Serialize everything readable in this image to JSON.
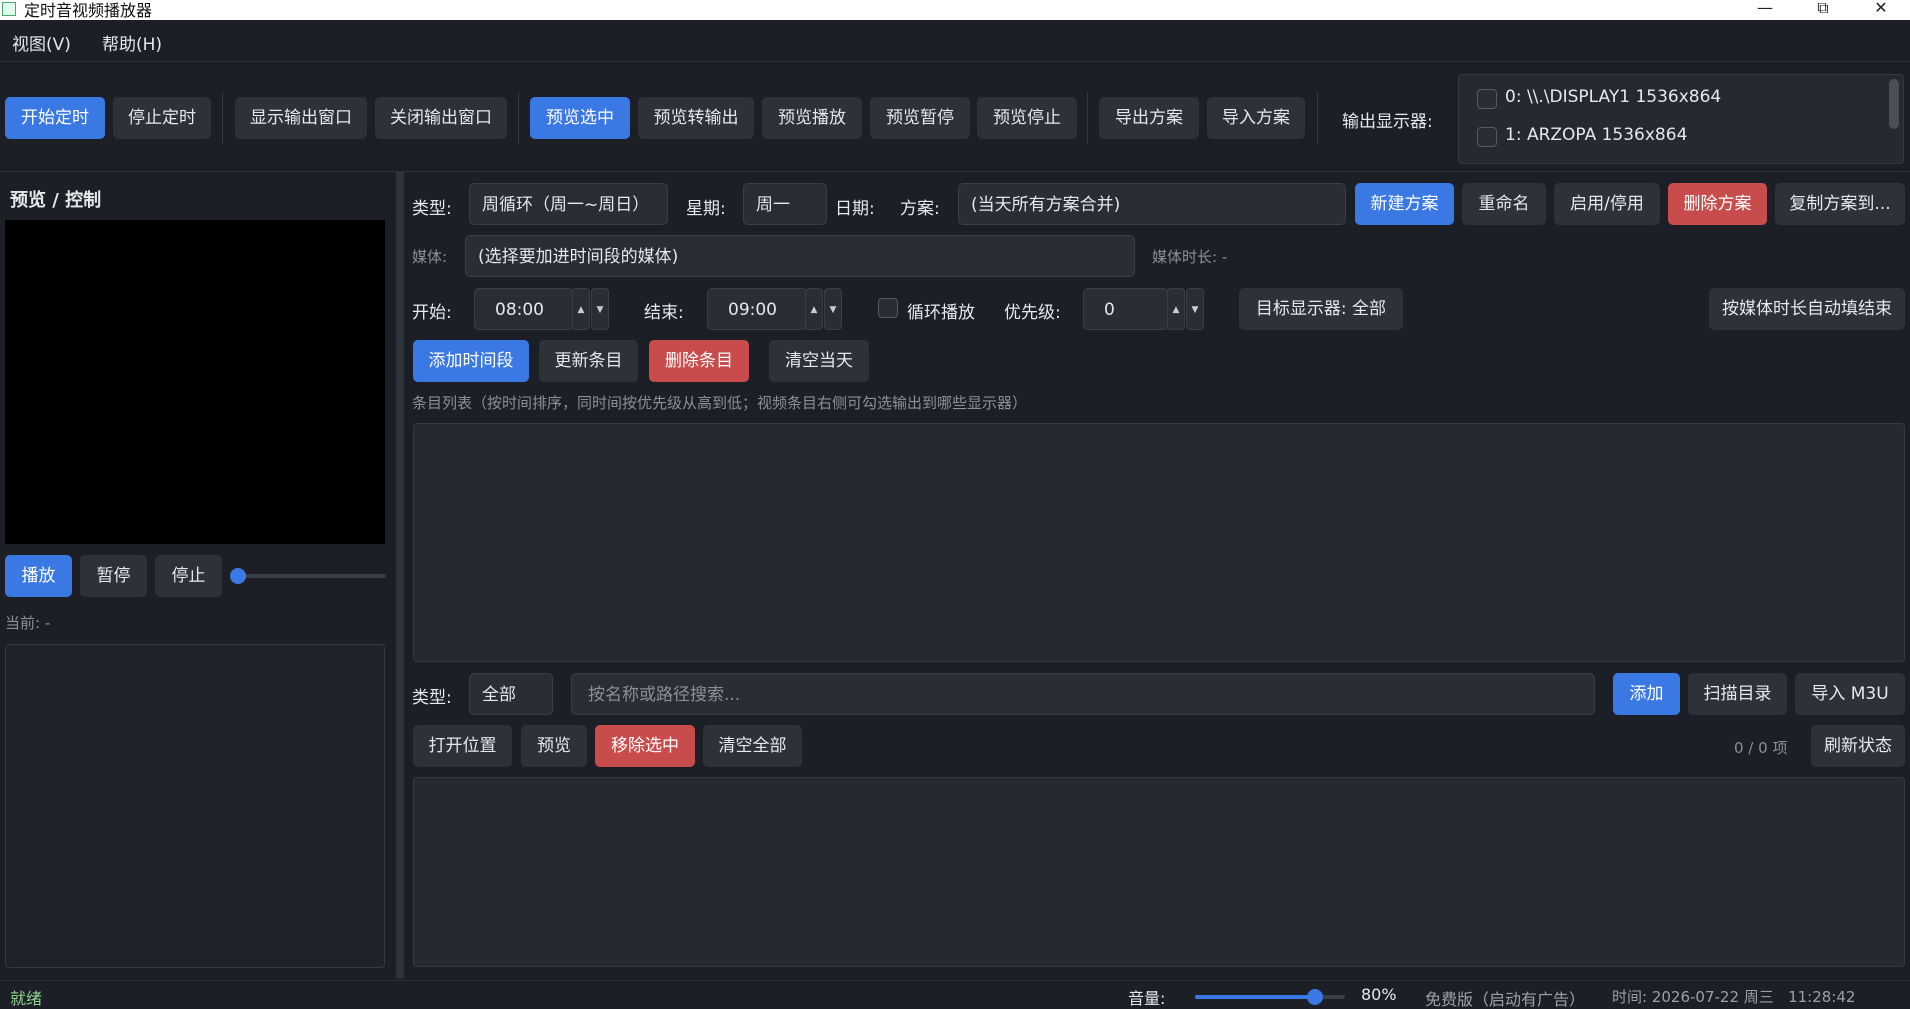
{
  "window": {
    "title": "定时音视频播放器",
    "minimize": "—",
    "maximize": "⧉",
    "close": "✕"
  },
  "menu": {
    "view": "视图(V)",
    "help": "帮助(H)"
  },
  "toolbar": {
    "start_timer": "开始定时",
    "stop_timer": "停止定时",
    "show_output": "显示输出窗口",
    "close_output": "关闭输出窗口",
    "preview_selected": "预览选中",
    "preview_to_output": "预览转输出",
    "preview_play": "预览播放",
    "preview_pause": "预览暂停",
    "preview_stop": "预览停止",
    "export_plan": "导出方案",
    "import_plan": "导入方案",
    "output_display_label": "输出显示器:",
    "displays": [
      "0: \\\\.\\DISPLAY1  1536x864",
      "1: ARZOPA  1536x864"
    ]
  },
  "left_panel": {
    "title": "预览 / 控制",
    "play": "播放",
    "pause": "暂停",
    "stop": "停止",
    "current": "当前: -"
  },
  "schedule": {
    "type_label": "类型:",
    "type_value": "周循环（周一~周日）",
    "weekday_label": "星期:",
    "weekday_value": "周一",
    "date_label": "日期:",
    "plan_label": "方案:",
    "plan_value": "(当天所有方案合并)",
    "new_plan": "新建方案",
    "rename": "重命名",
    "enable_disable": "启用/停用",
    "delete_plan": "删除方案",
    "copy_plan": "复制方案到...",
    "media_label": "媒体:",
    "media_value": "(选择要加进时间段的媒体)",
    "media_duration": "媒体时长: -",
    "start_label": "开始:",
    "start_value": "08:00",
    "end_label": "结束:",
    "end_value": "09:00",
    "loop_label": "循环播放",
    "priority_label": "优先级:",
    "priority_value": "0",
    "target_display": "目标显示器: 全部",
    "auto_fill_end": "按媒体时长自动填结束",
    "add_segment": "添加时间段",
    "update_item": "更新条目",
    "delete_item": "删除条目",
    "clear_day": "清空当天",
    "list_hint": "条目列表（按时间排序，同时间按优先级从高到低；视频条目右侧可勾选输出到哪些显示器）"
  },
  "library": {
    "type_label": "类型:",
    "type_value": "全部",
    "search_placeholder": "按名称或路径搜索...",
    "add": "添加",
    "scan_dir": "扫描目录",
    "import_m3u": "导入 M3U",
    "open_location": "打开位置",
    "preview": "预览",
    "remove_selected": "移除选中",
    "clear_all": "清空全部",
    "count": "0 / 0 项",
    "refresh_status": "刷新状态"
  },
  "status": {
    "ready": "就绪",
    "volume_label": "音量:",
    "volume_value": "80%",
    "volume_level": 0.8,
    "edition": "免费版（启动有广告）",
    "time": "时间: 2026-07-22 周三   11:28:42"
  },
  "colors": {
    "accent": "#3a78e4",
    "danger": "#c84c4c",
    "ready": "#8fd18f"
  }
}
